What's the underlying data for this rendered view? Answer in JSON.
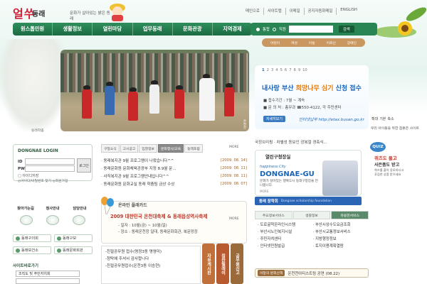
{
  "header": {
    "logo_main": "얼쑤",
    "logo_sub": "동래",
    "tagline": "문화가 살아있는 밝은 동래",
    "top_links": [
      "메인으로",
      "사이트맵",
      "이메일",
      "공지자동화메일",
      "ENGLISH"
    ]
  },
  "nav": {
    "items": [
      "원스톱민원",
      "생활정보",
      "열린마당",
      "업무동래",
      "문화관광",
      "지역경제"
    ]
  },
  "search": {
    "option_all": "통합",
    "option_staff": "직원",
    "placeholder": "",
    "button": "검색"
  },
  "subnav": {
    "items": [
      "어린이",
      "여성",
      "아동",
      "어르신",
      "장애인"
    ]
  },
  "hero": {
    "caption": "온천천",
    "left_caption": "동래학춤"
  },
  "banner": {
    "pager": [
      "1",
      "2",
      "3",
      "4",
      "5",
      "6",
      "7",
      "8",
      "9",
      "10"
    ],
    "active_page": "1",
    "headline_a": "내사랑 부산 ",
    "headline_b": "희망나무 심기 ",
    "headline_c": "신청 접수",
    "line1": "■ 접수기간 : 7월 ~ 계속",
    "line2": "■ 문 의 처 : 총무과 ☎550-4122, 각 주민센터",
    "more_label": "자세히보기",
    "etax": "인터넷납부 http://etax.busan.go.kr",
    "ctrl_prev": "확대",
    "ctrl_reset": "기본",
    "ctrl_next": "축소",
    "kids_text": "우리 아이들을 위한 참좋은 사이트"
  },
  "ticker": {
    "text": "국정브리핑 | 차별성 동보인 광복절 경축식..."
  },
  "login": {
    "title": "DONGNAE LOGIN",
    "id_label": "ID",
    "pw_label": "PW",
    "button": "로그인",
    "save_id": "아이디저장",
    "find_links": "◎아이디/비밀번호 찾기 ◎회원가입"
  },
  "quick": {
    "tabs": [
      "찾아가는길",
      "청사안내",
      "담당안내"
    ],
    "buttons": [
      "동래구의회",
      "동래구보",
      "동래보건소",
      "동래문화회관"
    ]
  },
  "shortcut": {
    "title": "사이트바로가기",
    "selected": "조직도 및 주민자치회"
  },
  "news": {
    "tabs": [
      "구청소식",
      "고시공고",
      "입찰정보",
      "문화행사/교육",
      "동래포럼"
    ],
    "active_tab": "문화행사/교육",
    "more": "MORE",
    "rows": [
      {
        "title": "· 동래복지관 9월 프로그램이 나왔습니다^^",
        "date": "[2009. 08. 14]"
      },
      {
        "title": "· 동래문화원 문화체육관광부 지정 8.9월 문...",
        "date": "[2009. 08. 11]"
      },
      {
        "title": "· 사직복지관 9월 프로그램안내입니다^^",
        "date": "[2009. 08. 11]"
      },
      {
        "title": "· 동래문화원 문화교실 동래 학춤팀 금상 수상",
        "date": "[2009. 08. 07]"
      }
    ]
  },
  "card": {
    "title": "온라인 플래카드",
    "headline": "2009 대한민국 온천대축제 & 동래읍성역사축제",
    "line1": "- 일자 : 10월(금) ~ 10월(일)",
    "line2": "- 장소 : 동래온천장 일대, 동래문화회관, 복문망장",
    "more": "MORE"
  },
  "notices": [
    "-친절공무원 접수(명정3동 명영미)",
    "-청탁에 주셔서 감사합니다",
    "-친절공무원접수(온천3동 이승현)"
  ],
  "side_tabs": {
    "a": "자유게시판",
    "b": "칭찬릴레이",
    "c": "공무원신고"
  },
  "colors": {
    "tab_a": "#c0703a",
    "tab_b": "#b85a30",
    "tab_c": "#9a6a3a"
  },
  "policy": {
    "text": "국정브리핑 · 차별성 동보인 광복절 경축식..."
  },
  "reserve": {
    "title": "열린구청장실",
    "sub": "happiness City",
    "big": "DONGNAE-GU",
    "desc": "문화가 살아있는 행복도시 동래구청장을 만나봅니다.",
    "more": "MORE"
  },
  "scholar": {
    "label": "동래 장학회",
    "sub": "Dongnae scholarship foundation"
  },
  "quiz": {
    "bubble": "QUIZ",
    "q1": "퀴즈도 풀고",
    "q2": "사은품도 받고",
    "desc": "퀴즈를 풀어 응모하시고 푸짐한 상품 받으세요"
  },
  "services": {
    "tabs": [
      "주요정보서비스",
      "생활정보",
      "유용한서비스"
    ],
    "active_tab": "유용한서비스",
    "items": [
      "도로굴착온라인시스템",
      "부산시상수도요금조회",
      "부산시노인복지시설",
      "부산시교통정보서비스",
      "주민자치센터",
      "지방행정정보",
      "인터넷민원발급",
      "토지이용계획열람"
    ]
  },
  "footer_banner": {
    "tag": "이달의 문화산책",
    "value": "온천천아티스트링 공연 (08.22)"
  }
}
